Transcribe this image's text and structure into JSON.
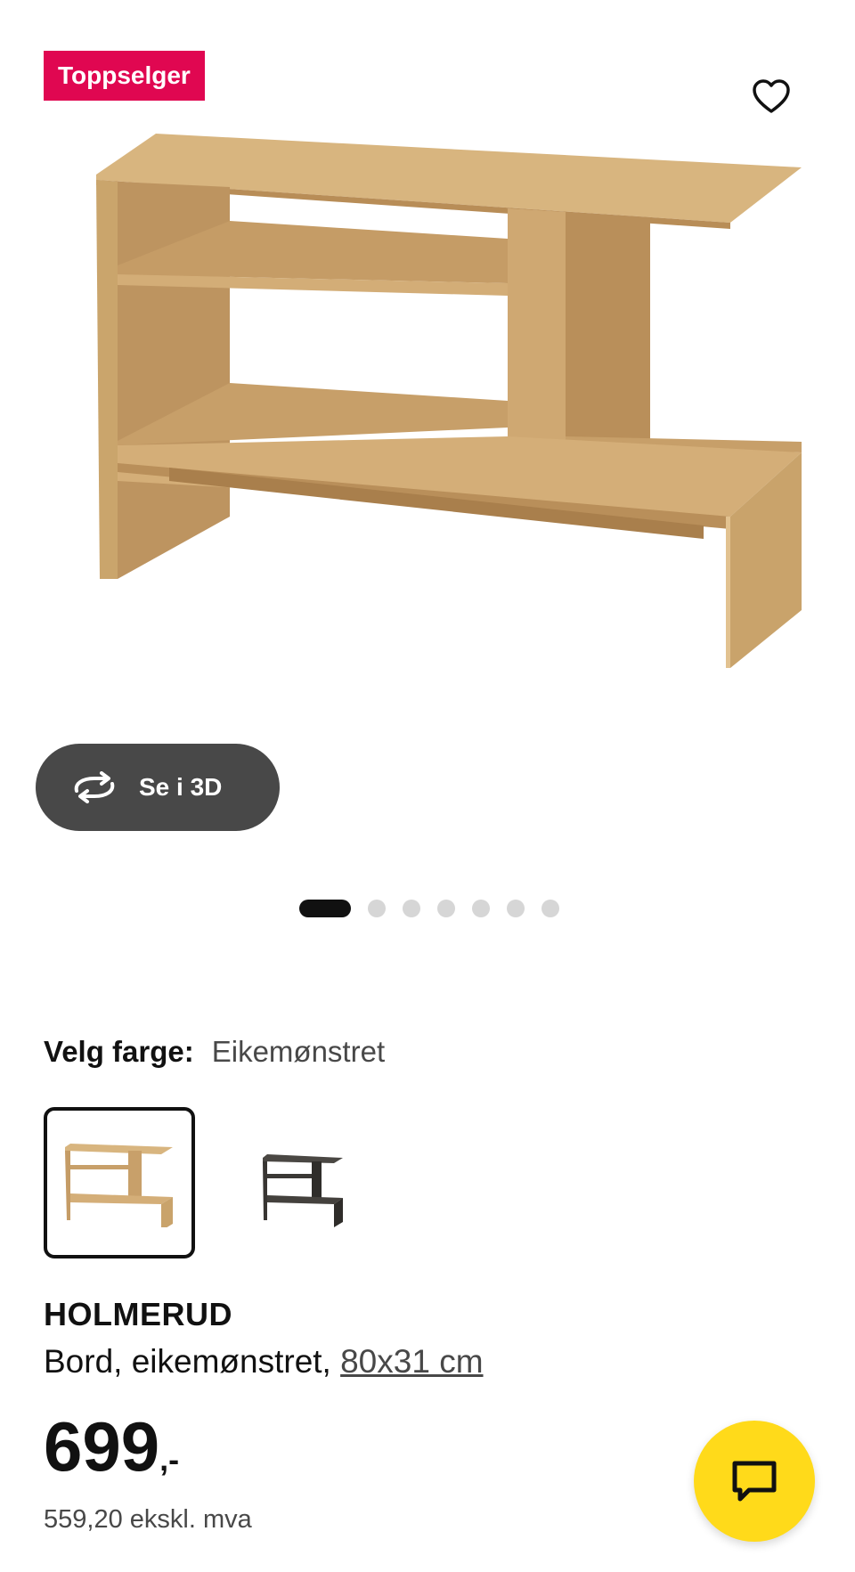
{
  "badge": {
    "label": "Toppselger",
    "color": "#e00751"
  },
  "favorite": {
    "icon": "heart-icon"
  },
  "view3d": {
    "label": "Se i 3D",
    "icon": "rotate-3d-icon"
  },
  "carousel": {
    "total": 7,
    "active_index": 0
  },
  "color_picker": {
    "label": "Velg farge:",
    "selected_value": "Eikemønstret",
    "options": [
      {
        "name": "Eikemønstret",
        "selected": true,
        "color": "#c9a66b"
      },
      {
        "name": "dark",
        "selected": false,
        "color": "#3a3835"
      }
    ]
  },
  "product": {
    "name": "HOLMERUD",
    "description": "Bord, eikemønstret, ",
    "size": "80x31 cm",
    "price_main": "699",
    "price_decimal": ",-",
    "price_ex_vat": "559,20 ekskl. mva"
  },
  "chat": {
    "icon": "chat-bubble-icon",
    "color": "#ffda1a"
  }
}
